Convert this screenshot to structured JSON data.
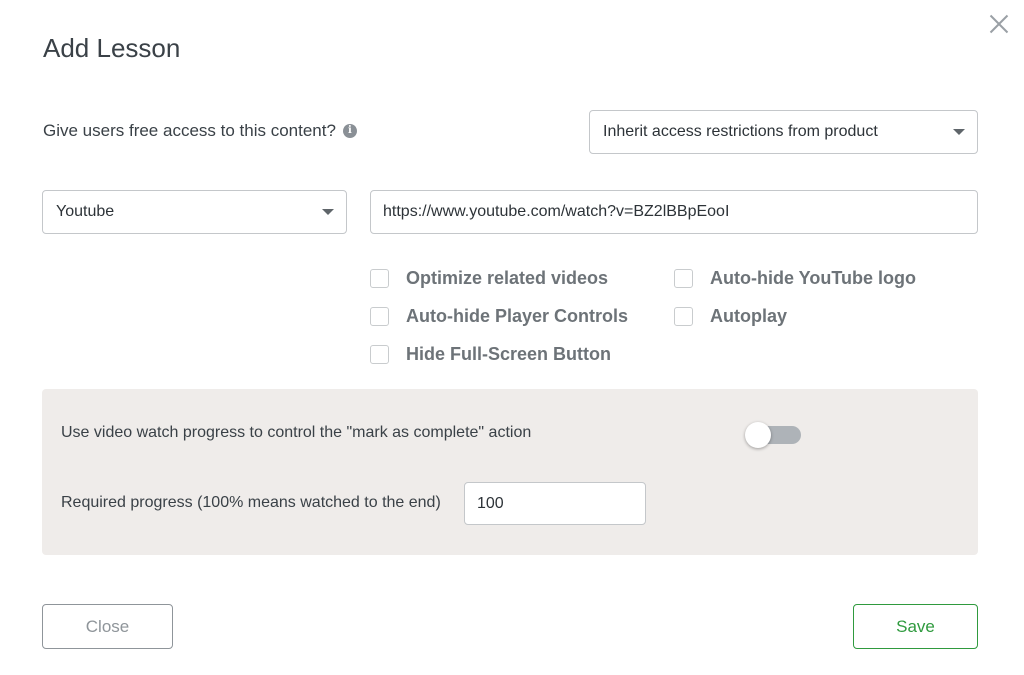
{
  "dialog": {
    "title": "Add Lesson"
  },
  "access": {
    "label": "Give users free access to this content?",
    "info_icon_glyph": "i",
    "selected_option": "Inherit access restrictions from product"
  },
  "video": {
    "source_selected": "Youtube",
    "url_value": "https://www.youtube.com/watch?v=BZ2lBBpEooI"
  },
  "options": {
    "optimize_related": "Optimize related videos",
    "autohide_logo": "Auto-hide YouTube logo",
    "autohide_controls": "Auto-hide Player Controls",
    "autoplay": "Autoplay",
    "hide_fullscreen": "Hide Full-Screen Button"
  },
  "progress": {
    "toggle_label": "Use video watch progress to control the \"mark as complete\" action",
    "toggle_on": false,
    "required_label": "Required progress (100% means watched to the end)",
    "required_value": "100"
  },
  "footer": {
    "close_label": "Close",
    "save_label": "Save"
  },
  "colors": {
    "save_accent": "#2f9a3e",
    "panel_background": "#efecea"
  }
}
